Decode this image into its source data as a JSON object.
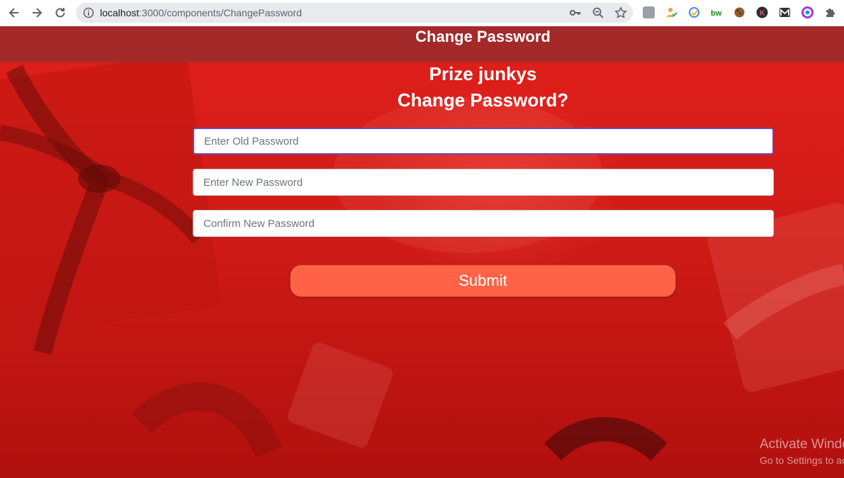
{
  "browser": {
    "url_host": "localhost",
    "url_path": ":3000/components/ChangePassword"
  },
  "header": {
    "title": "Change Password"
  },
  "main": {
    "brand": "Prize junkys",
    "subtitle": "Change Password?",
    "fields": {
      "old_password_placeholder": "Enter Old Password",
      "new_password_placeholder": "Enter New Password",
      "confirm_password_placeholder": "Confirm New Password"
    },
    "submit_label": "Submit"
  },
  "watermark": {
    "line1": "Activate Windows",
    "line2": "Go to Settings to activate Windows."
  },
  "colors": {
    "header_bar": "#a32a29",
    "background": "#d11b17",
    "submit": "#ff6347"
  }
}
